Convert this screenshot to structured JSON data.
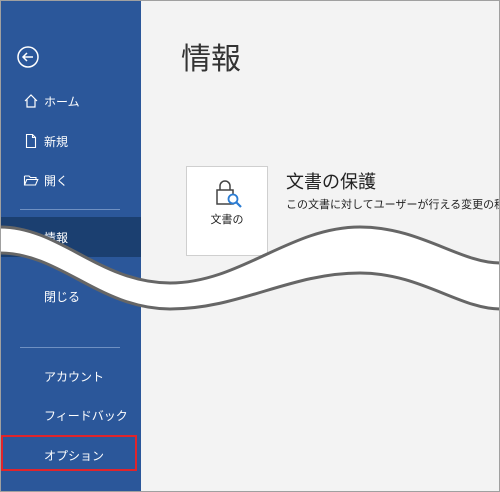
{
  "nav": {
    "items": [
      {
        "key": "home",
        "label": "ホーム",
        "icon": "home-icon"
      },
      {
        "key": "new",
        "label": "新規",
        "icon": "new-document-icon"
      },
      {
        "key": "open",
        "label": "開く",
        "icon": "open-folder-icon"
      },
      {
        "key": "info",
        "label": "情報",
        "active": true
      },
      {
        "key": "close",
        "label": "閉じる"
      },
      {
        "key": "account",
        "label": "アカウント"
      },
      {
        "key": "feedback",
        "label": "フィードバック"
      },
      {
        "key": "options",
        "label": "オプション",
        "highlighted": true
      }
    ],
    "back_icon": "back-arrow-icon"
  },
  "main": {
    "title": "情報",
    "protect": {
      "tile_label": "文書の",
      "tile_icon": "lock-search-icon",
      "heading": "文書の保護",
      "description": "この文書に対してユーザーが行える変更の種類"
    }
  },
  "colors": {
    "sidebar": "#2b579a",
    "sidebar_active": "#1b3f70",
    "highlight": "#e0242b",
    "content_bg": "#f3f3f3"
  }
}
